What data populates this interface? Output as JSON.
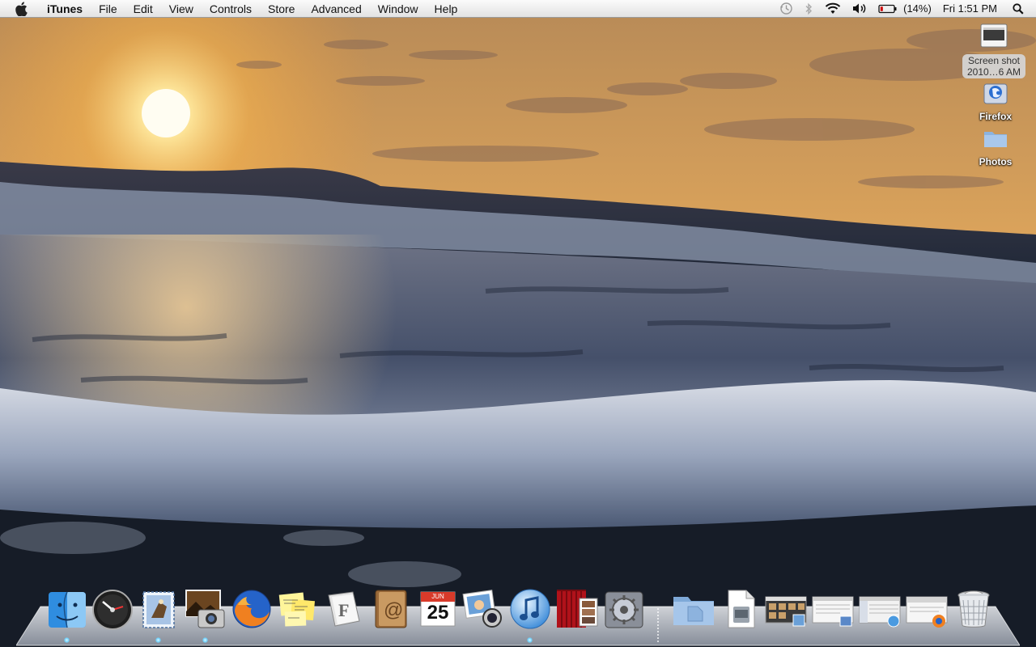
{
  "menubar": {
    "apple_icon": "apple-icon",
    "app_name": "iTunes",
    "menus": [
      "File",
      "Edit",
      "View",
      "Controls",
      "Store",
      "Advanced",
      "Window",
      "Help"
    ],
    "status": {
      "battery_text": "(14%)",
      "clock": "Fri 1:51 PM",
      "icons": [
        "time-machine-icon",
        "bluetooth-icon",
        "wifi-icon",
        "volume-icon",
        "battery-icon",
        "spotlight-icon"
      ]
    }
  },
  "desktop": {
    "icons": [
      {
        "label_line1": "Screen shot",
        "label_line2": "2010…6 AM",
        "icon": "screenshot-file-icon"
      },
      {
        "label": "Firefox",
        "icon": "firefox-disk-icon"
      },
      {
        "label": "Photos",
        "icon": "folder-icon"
      }
    ]
  },
  "dock": {
    "items": [
      {
        "name": "Finder",
        "icon": "finder-icon",
        "running": true
      },
      {
        "name": "Dashboard",
        "icon": "dashboard-icon",
        "running": false
      },
      {
        "name": "Mail",
        "icon": "mail-icon",
        "running": true
      },
      {
        "name": "Image Capture",
        "icon": "image-capture-icon",
        "running": true
      },
      {
        "name": "Firefox",
        "icon": "firefox-icon",
        "running": false
      },
      {
        "name": "Stickies",
        "icon": "stickies-icon",
        "running": false
      },
      {
        "name": "Font Book",
        "icon": "font-book-icon",
        "running": false
      },
      {
        "name": "Address Book",
        "icon": "address-book-icon",
        "running": false
      },
      {
        "name": "iCal",
        "icon": "ical-icon",
        "running": false,
        "date_month": "JUN",
        "date_day": "25"
      },
      {
        "name": "iPhoto",
        "icon": "iphoto-icon",
        "running": false
      },
      {
        "name": "iTunes",
        "icon": "itunes-icon",
        "running": true
      },
      {
        "name": "Photo Booth",
        "icon": "photo-booth-icon",
        "running": false
      },
      {
        "name": "System Preferences",
        "icon": "system-preferences-icon",
        "running": false
      },
      {
        "name": "Documents",
        "icon": "documents-folder-icon",
        "running": false
      },
      {
        "name": "Downloads",
        "icon": "downloads-stack-icon",
        "running": false
      },
      {
        "name": "iPhoto window",
        "icon": "minimized-window-icon",
        "running": false
      },
      {
        "name": "Preview window",
        "icon": "minimized-window-icon",
        "running": false
      },
      {
        "name": "iTunes window",
        "icon": "minimized-window-icon",
        "running": false
      },
      {
        "name": "Firefox window",
        "icon": "minimized-window-icon",
        "running": false
      },
      {
        "name": "Trash",
        "icon": "trash-icon",
        "running": false
      }
    ]
  },
  "colors": {
    "sky_top": "#d6a563",
    "sun": "#fff7d6",
    "sea_dark": "#1f2a3b",
    "foam": "#c9d1de",
    "run_indicator": "#6fd3ff"
  }
}
